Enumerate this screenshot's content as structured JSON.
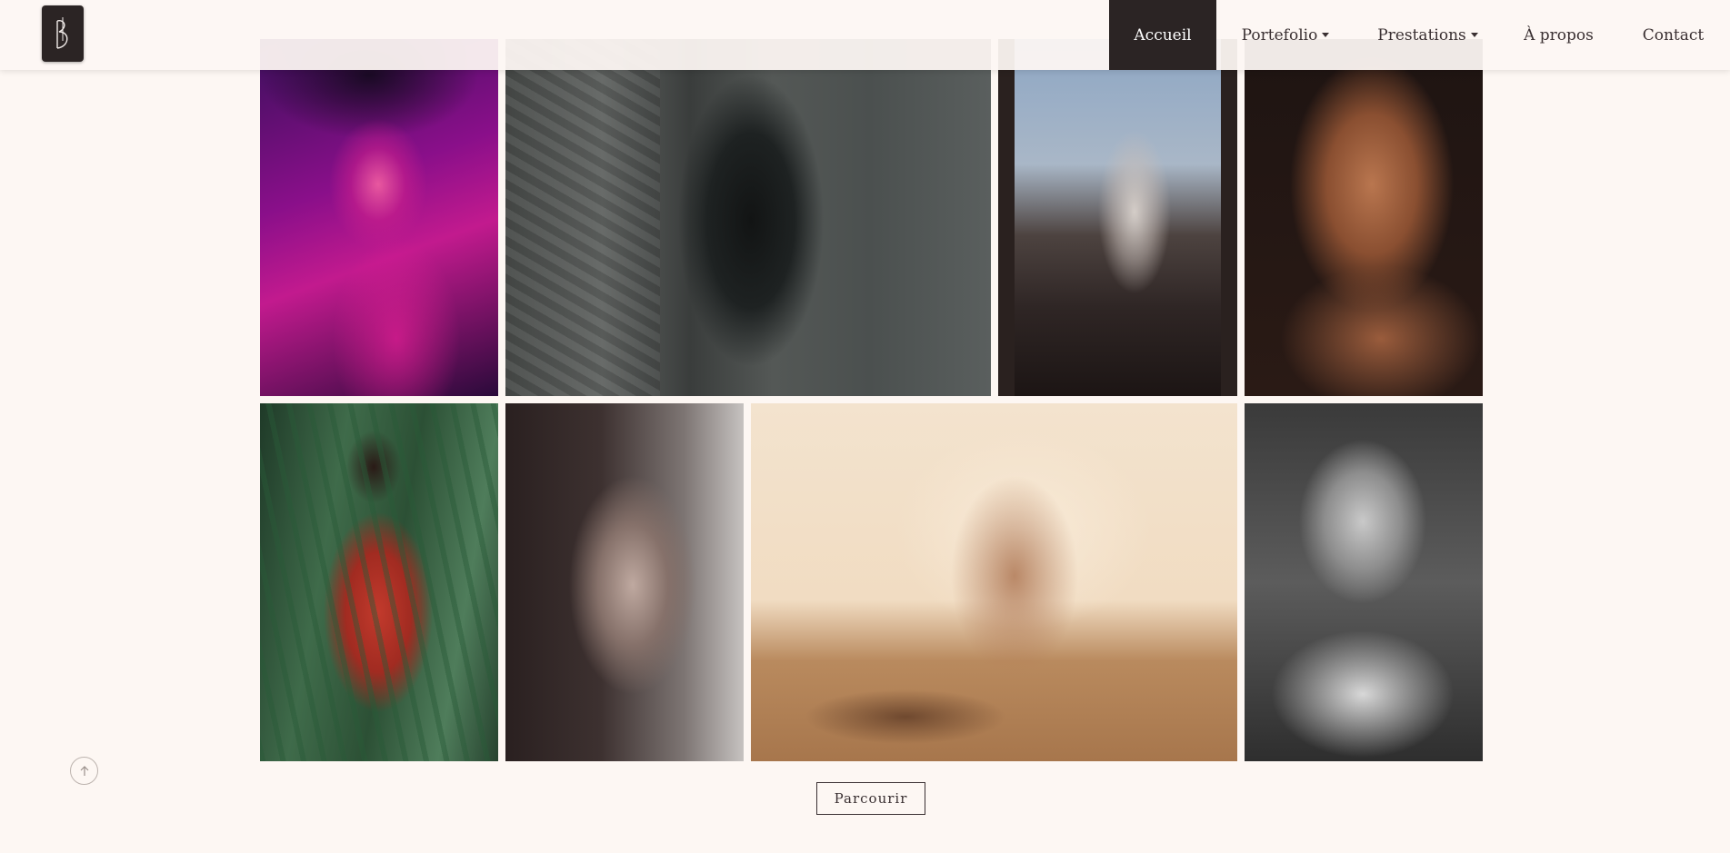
{
  "header": {
    "logo_icon": "monogram-logo-icon",
    "nav": [
      {
        "label": "Accueil",
        "active": true
      },
      {
        "label": "Portefolio",
        "dropdown": true
      },
      {
        "label": "Prestations",
        "dropdown": true
      },
      {
        "label": "À propos"
      },
      {
        "label": "Contact"
      }
    ]
  },
  "gallery": {
    "photos": [
      {
        "name": "photo-magenta-hat-portrait"
      },
      {
        "name": "photo-man-leaning-stone-wall"
      },
      {
        "name": "photo-woman-seated-window"
      },
      {
        "name": "photo-closeup-portrait"
      },
      {
        "name": "photo-woman-red-dress-reeds"
      },
      {
        "name": "photo-woman-kneeling-sofa"
      },
      {
        "name": "photo-woman-legs-raised-floor"
      },
      {
        "name": "photo-bw-portrait-lace"
      }
    ]
  },
  "browse_button": {
    "label": "Parcourir"
  },
  "scroll_top": {
    "icon": "arrow-up-icon"
  }
}
